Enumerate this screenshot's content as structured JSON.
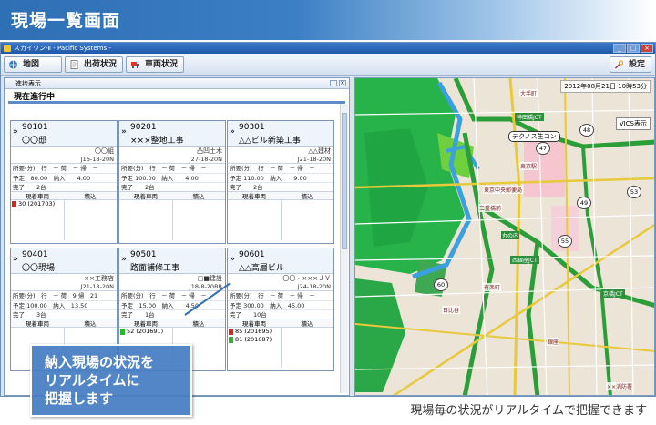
{
  "page": {
    "title": "現場一覧画面",
    "callout_lines": [
      "納入現場の状況を",
      "リアルタイムに",
      "把握します"
    ],
    "caption": "現場毎の状況がリアルタイムで把握できます"
  },
  "window": {
    "title": "スカイワン-Ⅱ - Pacific Systems -",
    "min": "_",
    "max": "□",
    "close": "×"
  },
  "toolbar": {
    "map": "地図",
    "shipping": "出荷状況",
    "vehicle": "車両状況",
    "settings": "設定"
  },
  "panel": {
    "title": "進捗表示",
    "section": "現在進行中",
    "grid_headers": [
      "現着車両",
      "積込"
    ]
  },
  "cards": [
    {
      "code": "90101",
      "name": "〇〇邸",
      "tag": "〇〇組",
      "rid": "J16-18-20N",
      "r1": "所要(分)　行　－ 荷　－ 帰　－",
      "r2": "予定　80.00　納入　　4.00",
      "r3": "完了　　2台",
      "vehicles": [
        {
          "label": "30 (201703)",
          "color": "#e02020"
        }
      ]
    },
    {
      "code": "90201",
      "name": "×××整地工事",
      "tag": "凸凹土木",
      "rid": "J27-18-20N",
      "r1": "所要(分)　行　－ 荷　－ 帰　－",
      "r2": "予定 100.00　納入　　4.00",
      "r3": "完了　　2台",
      "vehicles": []
    },
    {
      "code": "90301",
      "name": "△△ビル新築工事",
      "tag": "△△建材",
      "rid": "J21-18-20N",
      "r1": "所要(分)　行　－ 荷　－ 帰　－",
      "r2": "予定 110.00　納入　　9.00",
      "r3": "完了　　2台",
      "vehicles": []
    },
    {
      "code": "90401",
      "name": "〇〇現場",
      "tag": "××工務店",
      "rid": "J21-18-20N",
      "r1": "所要(分)　行　－ 荷　9 帰　21",
      "r2": "予定 100.00　納入　13.50",
      "r3": "完了　　3台",
      "vehicles": []
    },
    {
      "code": "90501",
      "name": "路面補修工事",
      "tag": "□■建設",
      "rid": "J18-8-20BB",
      "r1": "所要(分)　行　－ 荷　－ 帰　－",
      "r2": "予定　15.00　納入　　4.50",
      "r3": "完了　　1台",
      "vehicles": [
        {
          "label": "52 (201691)",
          "color": "#2db52d"
        }
      ]
    },
    {
      "code": "90601",
      "name": "△△高層ビル",
      "tag": "〇〇・×××ＪＶ",
      "rid": "J24-18-20N",
      "r1": "所要(分)　行　－ 荷　－ 帰　－",
      "r2": "予定 300.00　納入　45.00",
      "r3": "完了　　10台",
      "vehicles": [
        {
          "label": "85 (201695)",
          "color": "#e02020"
        },
        {
          "label": "81 (201687)",
          "color": "#2db52d"
        }
      ]
    }
  ],
  "map": {
    "date": "2012年08月21日 10時53分",
    "vics": "VICS表示",
    "landmark": "テクノス生コン",
    "markers": [
      "48",
      "47",
      "49",
      "55",
      "60",
      "53"
    ],
    "places": [
      "東京中央郵便局",
      "丸の内",
      "日比谷",
      "有楽町",
      "東京駅",
      "神田橋JCT",
      "西銀座JCT",
      "京橋JCT",
      "銀座",
      "××消防署",
      "二重橋前",
      "大手町"
    ]
  }
}
